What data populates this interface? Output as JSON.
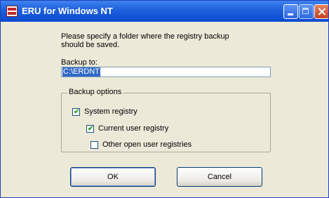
{
  "window": {
    "title": "ERU for Windows NT",
    "app_icon": "eru-app-icon",
    "caption_buttons": [
      "minimize-icon",
      "maximize-icon",
      "close-icon"
    ]
  },
  "dialog": {
    "instruction": "Please specify a folder where the registry backup should be saved.",
    "backup_to_label": "Backup to:",
    "backup_to_value": "C:\\ERDNT",
    "options": {
      "legend": "Backup options",
      "items": [
        {
          "label": "System registry",
          "checked": true
        },
        {
          "label": "Current user registry",
          "checked": true
        },
        {
          "label": "Other open user registries",
          "checked": false
        }
      ]
    },
    "buttons": {
      "ok": "OK",
      "cancel": "Cancel"
    }
  },
  "colors": {
    "titlebar": "#0a4ad0",
    "dialog_bg": "#ece9d8",
    "selection": "#316ac5",
    "check": "#21a121"
  }
}
